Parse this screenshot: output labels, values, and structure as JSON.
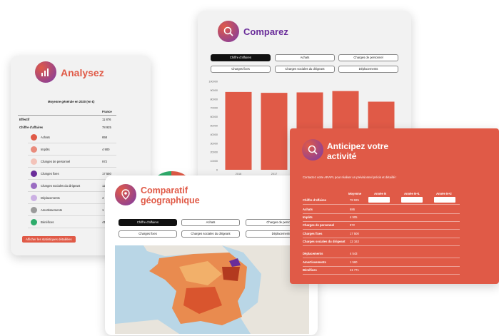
{
  "analysez": {
    "title": "Analysez",
    "table_caption": "Moyenne générale en 2020 (en €)",
    "col_header": "France",
    "effectif": {
      "label": "Effectif",
      "value": "11 876"
    },
    "ca": {
      "label": "Chiffre d'affaires",
      "value": "78 925"
    },
    "rows": [
      {
        "label": "Achats",
        "value": "658",
        "color": "#e05a47"
      },
      {
        "label": "Impôts",
        "value": "4 900",
        "color": "#e98b7c"
      },
      {
        "label": "Charges de personnel",
        "value": "972",
        "color": "#f3c3b9"
      },
      {
        "label": "Charges fixes",
        "value": "17 550",
        "color": "#6a2d9a"
      },
      {
        "label": "Charges sociales du dirigeant",
        "value": "12",
        "color": "#9a6cc2"
      },
      {
        "label": "Déplacements",
        "value": "4",
        "color": "#cbb0e3"
      },
      {
        "label": "Amortissements",
        "value": "1",
        "color": "#9a9a9a"
      },
      {
        "label": "Bénéfices",
        "value": "41",
        "color": "#2eac6b"
      }
    ],
    "button": "Afficher les statistiques détaillées"
  },
  "comparez": {
    "title": "Comparez",
    "pills_row1": [
      "Chiffre d'affaires",
      "Achats",
      "Charges de personnel"
    ],
    "pills_row2": [
      "Charges fixes",
      "Charges sociales du dirigeant",
      "Déplacements"
    ],
    "y_ticks": [
      "100000",
      "90000",
      "80000",
      "70000",
      "60000",
      "50000",
      "40000",
      "30000",
      "20000",
      "10000",
      "0"
    ]
  },
  "chart_data": {
    "type": "bar",
    "categories": [
      "2016",
      "2017",
      "",
      "",
      ""
    ],
    "values": [
      88000,
      87000,
      87500,
      89000,
      77000
    ],
    "ylim": [
      0,
      100000
    ],
    "color": "#e05a47"
  },
  "geo": {
    "title_line1": "Comparatif",
    "title_line2": "géographique",
    "pills_row1": [
      "Chiffre d'affaires",
      "Achats",
      "Charges de personnel"
    ],
    "pills_row2": [
      "Charges fixes",
      "Charges sociales du dirigeant",
      "Déplacements"
    ]
  },
  "anticipez": {
    "title_line1": "Anticipez votre",
    "title_line2": "activité",
    "subtitle": "Contactez votre ARAPL pour réaliser un prévisionnel précis et détaillé !",
    "headers": [
      "Moyenne",
      "Année N",
      "Année N+1",
      "Année N+2"
    ],
    "rows": [
      {
        "label": "Chiffre d'affaires",
        "value": "78 925"
      },
      {
        "label": "Achats",
        "value": "686"
      },
      {
        "label": "Impôts",
        "value": "4 905"
      },
      {
        "label": "Charges de personnel",
        "value": "972"
      },
      {
        "label": "Charges fixes",
        "value": "17 500"
      },
      {
        "label": "Charges sociales du dirigeant",
        "value": "12 163"
      },
      {
        "label": "Déplacements",
        "value": "4 543"
      },
      {
        "label": "Amortissements",
        "value": "1 560"
      },
      {
        "label": "Bénéfices",
        "value": "41 771"
      }
    ]
  },
  "colors": {
    "accent": "#e05a47",
    "card_bg": "#f2f2f2",
    "dark": "#111111"
  }
}
